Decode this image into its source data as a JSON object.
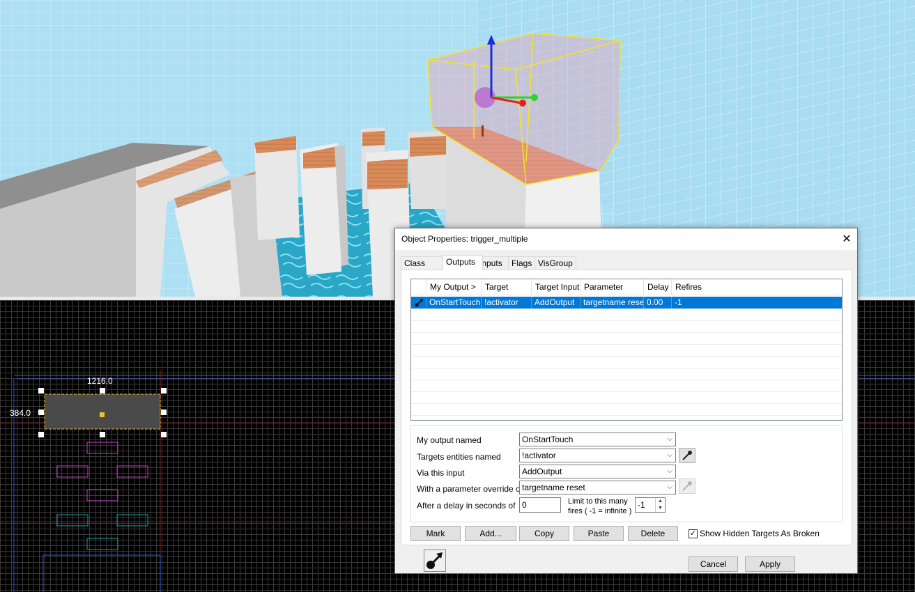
{
  "viewport2d": {
    "width_label": "1216.0",
    "height_label": "384.0"
  },
  "dialog": {
    "title": "Object Properties: trigger_multiple",
    "close_label": "✕",
    "tabs": [
      "Class Info",
      "Outputs",
      "Inputs",
      "Flags",
      "VisGroup"
    ],
    "active_tab": "Outputs",
    "outputs_table": {
      "columns": [
        "My Output  >",
        "Target Entity",
        "Target Input",
        "Parameter",
        "Delay",
        "Refires"
      ],
      "rows": [
        {
          "icon": "output-arrow-icon",
          "my_output": "OnStartTouch",
          "target_entity": "!activator",
          "target_input": "AddOutput",
          "parameter": "targetname reset",
          "delay": "0.00",
          "refires": "-1"
        }
      ]
    },
    "editor": {
      "output_label": "My output named",
      "output_value": "OnStartTouch",
      "target_label": "Targets entities named",
      "target_value": "!activator",
      "input_label": "Via this input",
      "input_value": "AddOutput",
      "param_label": "With a parameter override of",
      "param_value": "targetname reset",
      "delay_label": "After a delay in seconds of",
      "delay_value": "0",
      "limit_label_1": "Limit to this many",
      "limit_label_2": "fires ( -1 = infinite )",
      "limit_value": "-1"
    },
    "buttons": {
      "mark": "Mark",
      "add": "Add...",
      "copy": "Copy",
      "paste": "Paste",
      "delete": "Delete",
      "show_hidden": "Show Hidden Targets As Broken",
      "show_hidden_checked": true,
      "cancel": "Cancel",
      "apply": "Apply"
    },
    "colors": {
      "selection": "#0078d7"
    }
  }
}
